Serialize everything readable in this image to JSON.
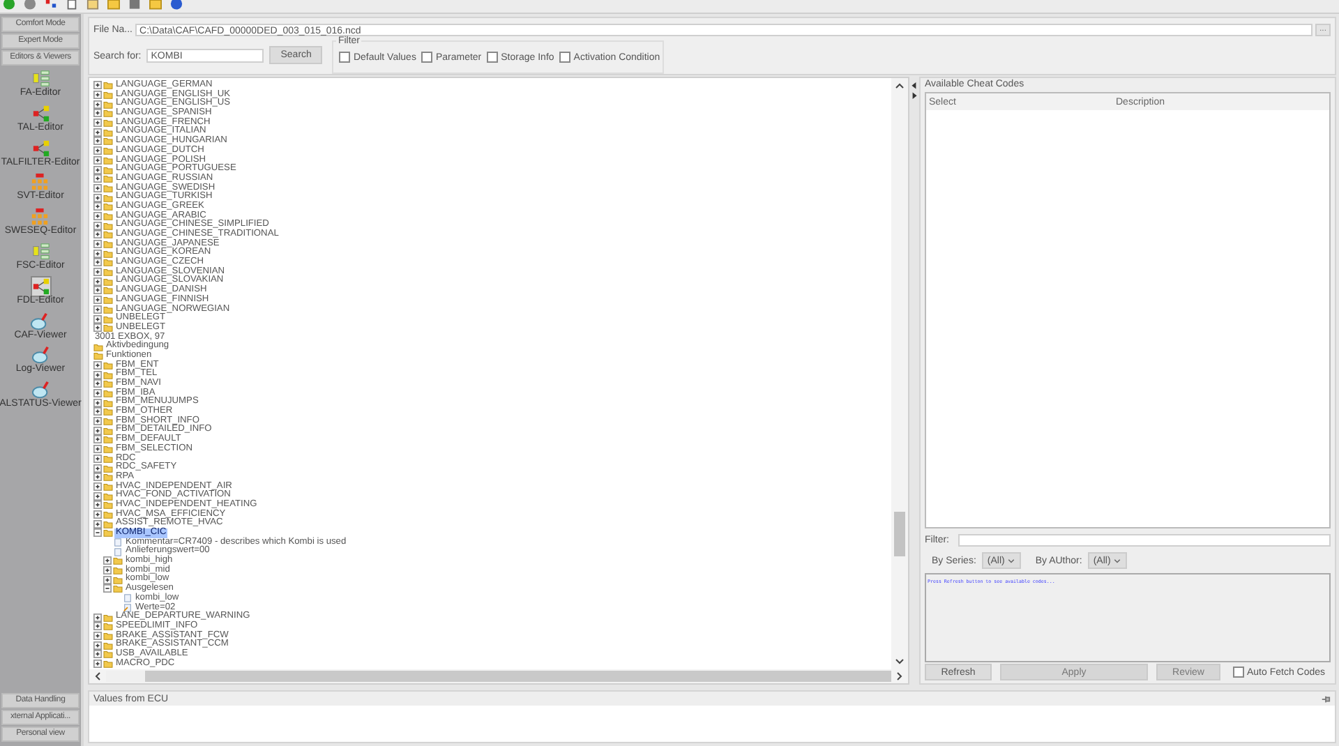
{
  "toolbar": {
    "icons": [
      {
        "kind": "green-dot"
      },
      {
        "kind": "gray-dot"
      },
      {
        "kind": "network"
      },
      {
        "kind": "document"
      },
      {
        "kind": "export"
      },
      {
        "kind": "folder"
      },
      {
        "kind": "save"
      },
      {
        "kind": "folder"
      },
      {
        "kind": "help"
      }
    ]
  },
  "sidebar": {
    "top_buttons": [
      "Comfort Mode",
      "Expert Mode",
      "Editors & Viewers"
    ],
    "items": [
      {
        "label": "FA-Editor",
        "kind": "list",
        "selected": false
      },
      {
        "label": "TAL-Editor",
        "kind": "network",
        "selected": false
      },
      {
        "label": "TALFILTER-Editor",
        "kind": "network",
        "selected": false
      },
      {
        "label": "SVT-Editor",
        "kind": "grid",
        "selected": false
      },
      {
        "label": "SWESEQ-Editor",
        "kind": "grid",
        "selected": false
      },
      {
        "label": "FSC-Editor",
        "kind": "list",
        "selected": false
      },
      {
        "label": "FDL-Editor",
        "kind": "network",
        "selected": true
      },
      {
        "label": "CAF-Viewer",
        "kind": "magnifier",
        "selected": false
      },
      {
        "label": "Log-Viewer",
        "kind": "magnifier",
        "selected": false
      },
      {
        "label": "ALSTATUS-Viewer",
        "kind": "magnifier",
        "selected": false
      }
    ],
    "bottom_buttons": [
      "Data Handling",
      "xternal Applicati...",
      "Personal view"
    ]
  },
  "file": {
    "label": "File Na...",
    "value": "C:\\Data\\CAF\\CAFD_00000DED_003_015_016.ncd",
    "browse": "..."
  },
  "search": {
    "label": "Search for:",
    "value": "KOMBI",
    "button": "Search"
  },
  "filter": {
    "title": "Filter",
    "options": [
      {
        "label": "Default Values",
        "checked": false
      },
      {
        "label": "Parameter",
        "checked": false
      },
      {
        "label": "Storage Info",
        "checked": false
      },
      {
        "label": "Activation Condition",
        "checked": false
      }
    ]
  },
  "tree": [
    {
      "kind": "group",
      "children": [
        {
          "label": "LANGUAGE_GERMAN",
          "kind": "folder",
          "expanded": false,
          "selected": false
        },
        {
          "label": "LANGUAGE_ENGLISH_UK",
          "kind": "folder",
          "expanded": false,
          "selected": false
        },
        {
          "label": "LANGUAGE_ENGLISH_US",
          "kind": "folder",
          "expanded": false,
          "selected": false
        },
        {
          "label": "LANGUAGE_SPANISH",
          "kind": "folder",
          "expanded": false,
          "selected": false
        },
        {
          "label": "LANGUAGE_FRENCH",
          "kind": "folder",
          "expanded": false,
          "selected": false
        },
        {
          "label": "LANGUAGE_ITALIAN",
          "kind": "folder",
          "expanded": false,
          "selected": false
        },
        {
          "label": "LANGUAGE_HUNGARIAN",
          "kind": "folder",
          "expanded": false,
          "selected": false
        },
        {
          "label": "LANGUAGE_DUTCH",
          "kind": "folder",
          "expanded": false,
          "selected": false
        },
        {
          "label": "LANGUAGE_POLISH",
          "kind": "folder",
          "expanded": false,
          "selected": false
        },
        {
          "label": "LANGUAGE_PORTUGUESE",
          "kind": "folder",
          "expanded": false,
          "selected": false
        },
        {
          "label": "LANGUAGE_RUSSIAN",
          "kind": "folder",
          "expanded": false,
          "selected": false
        },
        {
          "label": "LANGUAGE_SWEDISH",
          "kind": "folder",
          "expanded": false,
          "selected": false
        },
        {
          "label": "LANGUAGE_TURKISH",
          "kind": "folder",
          "expanded": false,
          "selected": false
        },
        {
          "label": "LANGUAGE_GREEK",
          "kind": "folder",
          "expanded": false,
          "selected": false
        },
        {
          "label": "LANGUAGE_ARABIC",
          "kind": "folder",
          "expanded": false,
          "selected": false
        },
        {
          "label": "LANGUAGE_CHINESE_SIMPLIFIED",
          "kind": "folder",
          "expanded": false,
          "selected": false
        },
        {
          "label": "LANGUAGE_CHINESE_TRADITIONAL",
          "kind": "folder",
          "expanded": false,
          "selected": false
        },
        {
          "label": "LANGUAGE_JAPANESE",
          "kind": "folder",
          "expanded": false,
          "selected": false
        },
        {
          "label": "LANGUAGE_KOREAN",
          "kind": "folder",
          "expanded": false,
          "selected": false
        },
        {
          "label": "LANGUAGE_CZECH",
          "kind": "folder",
          "expanded": false,
          "selected": false
        },
        {
          "label": "LANGUAGE_SLOVENIAN",
          "kind": "folder",
          "expanded": false,
          "selected": false
        },
        {
          "label": "LANGUAGE_SLOVAKIAN",
          "kind": "folder",
          "expanded": false,
          "selected": false
        },
        {
          "label": "LANGUAGE_DANISH",
          "kind": "folder",
          "expanded": false,
          "selected": false
        },
        {
          "label": "LANGUAGE_FINNISH",
          "kind": "folder",
          "expanded": false,
          "selected": false
        },
        {
          "label": "LANGUAGE_NORWEGIAN",
          "kind": "folder",
          "expanded": false,
          "selected": false
        },
        {
          "label": "UNBELEGT",
          "kind": "folder",
          "expanded": false,
          "selected": false
        },
        {
          "label": "UNBELEGT",
          "kind": "folder",
          "expanded": false,
          "selected": false
        }
      ]
    },
    {
      "label": "3001 EXBOX, 97",
      "kind": "text",
      "selected": false
    },
    {
      "label": "Aktivbedingung",
      "kind": "folder",
      "selected": false
    },
    {
      "label": "Funktionen",
      "kind": "folder",
      "selected": false,
      "children": [
        {
          "label": "FBM_ENT",
          "kind": "folder",
          "expanded": false,
          "selected": false
        },
        {
          "label": "FBM_TEL",
          "kind": "folder",
          "expanded": false,
          "selected": false
        },
        {
          "label": "FBM_NAVI",
          "kind": "folder",
          "expanded": false,
          "selected": false
        },
        {
          "label": "FBM_IBA",
          "kind": "folder",
          "expanded": false,
          "selected": false
        },
        {
          "label": "FBM_MENUJUMPS",
          "kind": "folder",
          "expanded": false,
          "selected": false
        },
        {
          "label": "FBM_OTHER",
          "kind": "folder",
          "expanded": false,
          "selected": false
        },
        {
          "label": "FBM_SHORT_INFO",
          "kind": "folder",
          "expanded": false,
          "selected": false
        },
        {
          "label": "FBM_DETAILED_INFO",
          "kind": "folder",
          "expanded": false,
          "selected": false
        },
        {
          "label": "FBM_DEFAULT",
          "kind": "folder",
          "expanded": false,
          "selected": false
        },
        {
          "label": "FBM_SELECTION",
          "kind": "folder",
          "expanded": false,
          "selected": false
        },
        {
          "label": "RDC",
          "kind": "folder",
          "expanded": false,
          "selected": false
        },
        {
          "label": "RDC_SAFETY",
          "kind": "folder",
          "expanded": false,
          "selected": false
        },
        {
          "label": "RPA",
          "kind": "folder",
          "expanded": false,
          "selected": false
        },
        {
          "label": "HVAC_INDEPENDENT_AIR",
          "kind": "folder",
          "expanded": false,
          "selected": false
        },
        {
          "label": "HVAC_FOND_ACTIVATION",
          "kind": "folder",
          "expanded": false,
          "selected": false
        },
        {
          "label": "HVAC_INDEPENDENT_HEATING",
          "kind": "folder",
          "expanded": false,
          "selected": false
        },
        {
          "label": "HVAC_MSA_EFFICIENCY",
          "kind": "folder",
          "expanded": false,
          "selected": false
        },
        {
          "label": "ASSIST_REMOTE_HVAC",
          "kind": "folder",
          "expanded": false,
          "selected": false
        },
        {
          "label": "KOMBI_CIC",
          "kind": "folder",
          "expanded": true,
          "selected": true,
          "children": [
            {
              "label": "Kommentar=CR7409 - describes which Kombi is used",
              "kind": "leaf",
              "selected": false
            },
            {
              "label": "Anlieferungswert=00",
              "kind": "leaf",
              "selected": false
            },
            {
              "label": "kombi_high",
              "kind": "folder",
              "expanded": false,
              "selected": false
            },
            {
              "label": "kombi_mid",
              "kind": "folder",
              "expanded": false,
              "selected": false
            },
            {
              "label": "kombi_low",
              "kind": "folder",
              "expanded": false,
              "selected": false
            },
            {
              "label": "Ausgelesen",
              "kind": "folder",
              "expanded": true,
              "selected": false,
              "children": [
                {
                  "label": "kombi_low",
                  "kind": "leaf",
                  "selected": false
                },
                {
                  "label": "Werte=02",
                  "kind": "value",
                  "selected": false
                }
              ]
            }
          ]
        },
        {
          "label": "LANE_DEPARTURE_WARNING",
          "kind": "folder",
          "expanded": false,
          "selected": false
        },
        {
          "label": "SPEEDLIMIT_INFO",
          "kind": "folder",
          "expanded": false,
          "selected": false
        },
        {
          "label": "BRAKE_ASSISTANT_FCW",
          "kind": "folder",
          "expanded": false,
          "selected": false
        },
        {
          "label": "BRAKE_ASSISTANT_CCM",
          "kind": "folder",
          "expanded": false,
          "selected": false
        },
        {
          "label": "USB_AVAILABLE",
          "kind": "folder",
          "expanded": false,
          "selected": false
        },
        {
          "label": "MACRO_PDC",
          "kind": "folder",
          "expanded": false,
          "selected": false
        }
      ]
    }
  ],
  "cheat_codes": {
    "title": "Available Cheat Codes",
    "columns": [
      "Select",
      "Description"
    ],
    "filter_label": "Filter:",
    "series_label": "By Series:",
    "series_value": "(All)",
    "author_label": "By AUthor:",
    "author_value": "(All)",
    "message": "Press Refresh button to see available codes...",
    "buttons": [
      {
        "label": "Refresh",
        "disabled": false
      },
      {
        "label": "Apply",
        "disabled": true
      },
      {
        "label": "Review",
        "disabled": true
      }
    ],
    "auto_fetch": {
      "label": "Auto Fetch Codes",
      "checked": false
    }
  },
  "values_panel": {
    "title": "Values from ECU"
  }
}
